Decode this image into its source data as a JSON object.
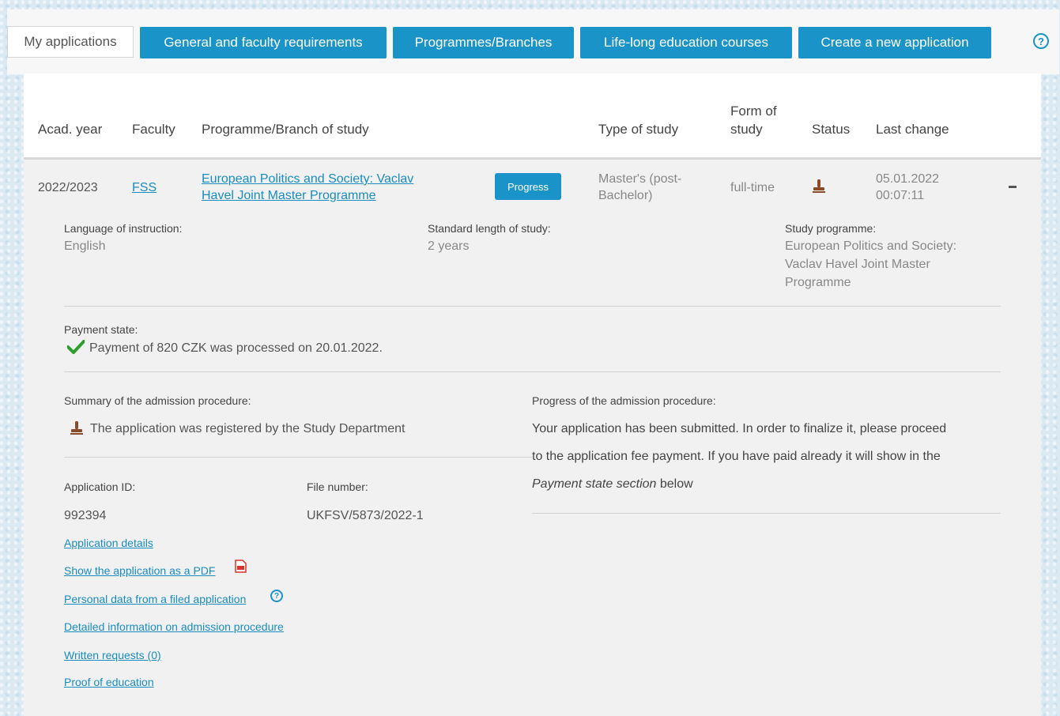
{
  "tabs": {
    "my_applications": "My applications",
    "requirements": "General and faculty requirements",
    "programmes": "Programmes/Branches",
    "lifelong": "Life-long education courses",
    "create": "Create a new application"
  },
  "help_icon": "question-circle-icon",
  "table": {
    "headers": {
      "acad_year": "Acad. year",
      "faculty": "Faculty",
      "programme": "Programme/Branch of study",
      "type": "Type of study",
      "form_line1": "Form of",
      "form_line2": "study",
      "status": "Status",
      "last_change": "Last change"
    },
    "row": {
      "acad_year": "2022/2023",
      "faculty": "FSS",
      "programme_line1": "European Politics and Society: Vaclav",
      "programme_line2": "Havel Joint Master Programme",
      "progress_button": "Progress",
      "type_line1": "Master's (post-",
      "type_line2": "Bachelor)",
      "form": "full-time",
      "status_icon": "stamp-icon",
      "last_change_date": "05.01.2022",
      "last_change_time": "00:07:11"
    }
  },
  "details": {
    "language_label": "Language of instruction:",
    "language_value": "English",
    "length_label": "Standard length of study:",
    "length_value": "2 years",
    "programme_label": "Study programme:",
    "programme_value_line1": "European Politics and Society:",
    "programme_value_line2": "Vaclav Havel Joint Master",
    "programme_value_line3": "Programme",
    "payment_label": "Payment state:",
    "payment_value": "Payment of 820 CZK was processed on 20.01.2022.",
    "summary_label": "Summary of the admission procedure:",
    "summary_value": "The application was registered by the Study Department",
    "progress_label": "Progress of the admission procedure:",
    "progress_line1": "Your application has been submitted. In order to finalize it, please proceed",
    "progress_line2": "to the application fee payment. If you have paid already it will show in the",
    "progress_line3_italic": "Payment state section",
    "progress_line3_rest": " below",
    "app_id_label": "Application ID:",
    "app_id_value": "992394",
    "file_number_label": "File number:",
    "file_number_value": "UKFSV/5873/2022-1",
    "links": {
      "details": "Application details",
      "pdf": "Show the application as a PDF",
      "personal": "Personal data from a filed application",
      "detailed_info": "Detailed information on admission procedure",
      "written": "Written requests (0)",
      "proof": "Proof of education"
    }
  },
  "colors": {
    "accent": "#1a94c8",
    "check": "#2e9e2e",
    "stamp": "#8a4b2a",
    "pdf": "#d9342b"
  }
}
